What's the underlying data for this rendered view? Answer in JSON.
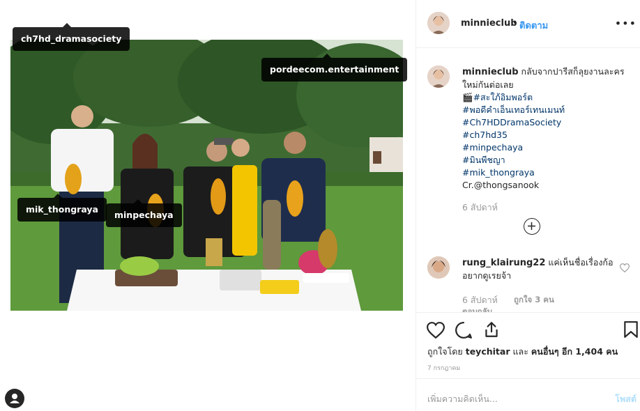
{
  "post": {
    "author": "minnieclub",
    "follow_label": "ติดตาม",
    "separator": "•",
    "more_label": "•••"
  },
  "photo_tags": [
    {
      "label": "ch7hd_dramasociety"
    },
    {
      "label": "pordeecom.entertainment"
    },
    {
      "label": "mik_thongraya"
    },
    {
      "label": "minpechaya"
    }
  ],
  "caption": {
    "author": "minnieclub",
    "text": "กลับจากปารีสก็ลุยงานละครใหม่กันต่อเลย",
    "emoji": "🎬",
    "lines": [
      "#สะใภ้อิมพอร์ต",
      "#พอดีคำเอ็นเทอร์เทนเมนท์",
      "#Ch7HDDramaSociety",
      "#ch7hd35",
      "#minpechaya",
      "#มินพีชญา",
      "#mik_thongraya"
    ],
    "credit": "Cr.@thongsanook",
    "time": "6 สัปดาห์"
  },
  "comments": [
    {
      "author": "rung_klairung22",
      "text": "แค่เห็นชื่อเรื่องก้ออยากดูเรยจ้า",
      "time": "6 สัปดาห์",
      "likes": "ถูกใจ 3 คน",
      "reply": "ตอบกลับ"
    }
  ],
  "likes_line": {
    "prefix": "ถูกใจโดย",
    "user": "teychitar",
    "conj": "และ",
    "others": "คนอื่นๆ อีก 1,404 คน"
  },
  "date": "7 กรกฎาคม",
  "comment_box": {
    "placeholder": "เพิ่มความคิดเห็น...",
    "post_label": "โพสต์"
  },
  "icons": {
    "like": "heart-icon",
    "comment": "comment-bubble-icon",
    "share": "share-icon",
    "save": "bookmark-icon",
    "add_comment_expand": "plus-circle-icon",
    "tags_toggle": "user-tag-icon"
  },
  "colors": {
    "link": "#003569",
    "follow": "#3897f0",
    "muted": "#999999",
    "post_disabled": "#b2dffc"
  }
}
